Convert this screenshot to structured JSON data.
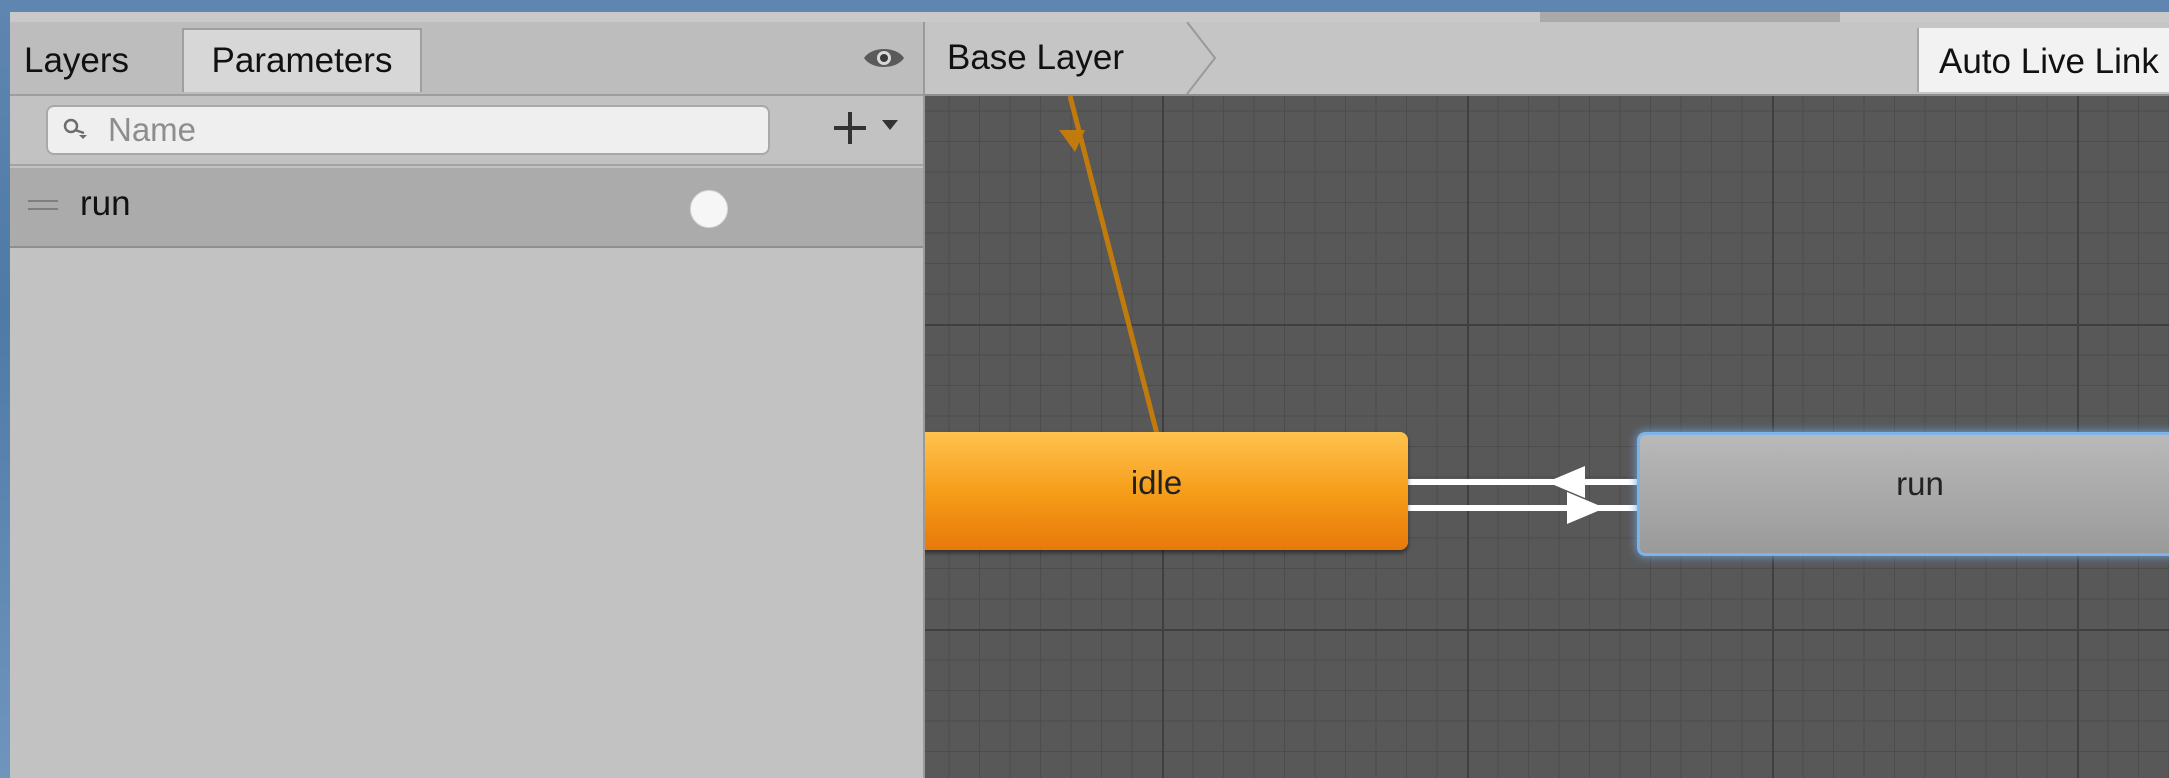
{
  "left_panel": {
    "tabs": [
      {
        "label": "Layers"
      },
      {
        "label": "Parameters"
      }
    ],
    "search": {
      "placeholder": "Name"
    },
    "parameters": [
      {
        "name": "run",
        "type": "trigger"
      }
    ]
  },
  "graph": {
    "breadcrumb": "Base Layer",
    "auto_live_link": "Auto Live Link",
    "states": [
      {
        "name": "idle",
        "default": true,
        "color": "#f39317"
      },
      {
        "name": "run",
        "default": false,
        "selected": true,
        "color": "#a6a6a6"
      }
    ],
    "colors": {
      "transition": "#ffffff",
      "entry_transition": "#c17a0c",
      "grid": "#585858"
    }
  }
}
